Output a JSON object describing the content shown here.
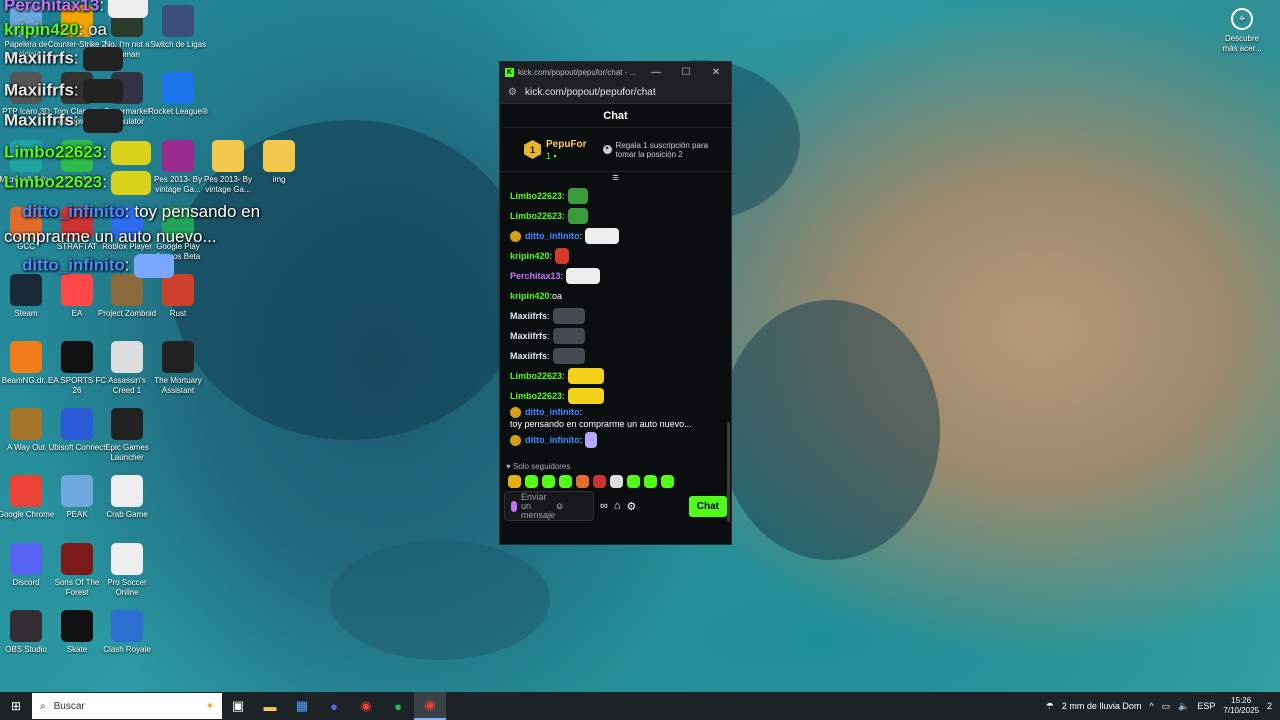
{
  "desktop_icons": [
    {
      "label": "Papelera de reciclaje",
      "icon": "recycle-bin-icon",
      "color": "#6aa6d9"
    },
    {
      "label": "Counter-Strike 2",
      "icon": "cs2-icon",
      "color": "#f0a500"
    },
    {
      "label": "No, I'm not a Human",
      "icon": "game-icon",
      "color": "#2b3b2b"
    },
    {
      "label": "Switch de Ligas",
      "icon": "league-icon",
      "color": "#3a4e7a"
    },
    {
      "label": "PTP Icaro 3D",
      "icon": "ptp-icon",
      "color": "#555"
    },
    {
      "label": "Tom Clancy's Rainbow Six",
      "icon": "r6-icon",
      "color": "#333"
    },
    {
      "label": "Supermarket Simulator",
      "icon": "supermarket-icon",
      "color": "#334"
    },
    {
      "label": "Rocket League®",
      "icon": "rocket-league-icon",
      "color": "#1a73e8"
    },
    {
      "label": "Microsoft Edge",
      "icon": "edge-icon",
      "color": "#1fa3a3"
    },
    {
      "label": "WhatsApp",
      "icon": "app-icon",
      "color": "#2dbb4d"
    },
    {
      "label": "Pes 2013- By vintage Ga...",
      "icon": "rar-icon",
      "color": "#9b2b8e"
    },
    {
      "label": "Pes 2013- By vintage Ga...",
      "icon": "folder-icon",
      "color": "#f2c94c"
    },
    {
      "label": "img",
      "icon": "folder-icon",
      "color": "#f2c94c"
    },
    {
      "label": "GCC",
      "icon": "gcc-icon",
      "color": "#e06b2d"
    },
    {
      "label": "STRAFTAT",
      "icon": "straftat-icon",
      "color": "#c33"
    },
    {
      "label": "Roblox Player",
      "icon": "roblox-icon",
      "color": "#2b6cf0"
    },
    {
      "label": "Google Play Juegos Beta",
      "icon": "play-games-icon",
      "color": "#22a55a"
    },
    {
      "label": "Steam",
      "icon": "steam-icon",
      "color": "#1b2838"
    },
    {
      "label": "EA",
      "icon": "ea-icon",
      "color": "#ff4747"
    },
    {
      "label": "Project Zomboid",
      "icon": "zomboid-icon",
      "color": "#8a6a3a"
    },
    {
      "label": "Rust",
      "icon": "rust-icon",
      "color": "#cd412b"
    },
    {
      "label": "BeamNG.dr...",
      "icon": "beamng-icon",
      "color": "#f07c1a"
    },
    {
      "label": "EA SPORTS FC 26",
      "icon": "fc26-icon",
      "color": "#111"
    },
    {
      "label": "Assassin's Creed 1",
      "icon": "assassins-creed-icon",
      "color": "#ddd"
    },
    {
      "label": "The Mortuary Assistant",
      "icon": "mortuary-icon",
      "color": "#222"
    },
    {
      "label": "A Way Out",
      "icon": "a-way-out-icon",
      "color": "#a3742a"
    },
    {
      "label": "Ubisoft Connect",
      "icon": "ubisoft-icon",
      "color": "#2a5bd7"
    },
    {
      "label": "Epic Games Launcher",
      "icon": "epic-icon",
      "color": "#222"
    },
    {
      "label": "Google Chrome",
      "icon": "chrome-icon",
      "color": "#ea4335"
    },
    {
      "label": "PEAK",
      "icon": "peak-icon",
      "color": "#6fa8dc"
    },
    {
      "label": "Crab Game",
      "icon": "crab-game-icon",
      "color": "#eee"
    },
    {
      "label": "Discord",
      "icon": "discord-icon",
      "color": "#5865f2"
    },
    {
      "label": "Sons Of The Forest",
      "icon": "sons-forest-icon",
      "color": "#7a1a1a"
    },
    {
      "label": "Pro Soccer Online",
      "icon": "soccer-icon",
      "color": "#eee"
    },
    {
      "label": "OBS Studio",
      "icon": "obs-icon",
      "color": "#302e31"
    },
    {
      "label": "Skate",
      "icon": "skate-icon",
      "color": "#111"
    },
    {
      "label": "Clash Royale",
      "icon": "clash-royale-icon",
      "color": "#2d6fd1"
    }
  ],
  "overlay_chat": [
    {
      "user": "Perchitax13",
      "text": ":",
      "color": "purple"
    },
    {
      "user": "kripin420",
      "text": ": oa",
      "color": "green"
    },
    {
      "user": "Maxiifrfs",
      "text": ":",
      "color": "white"
    },
    {
      "user": "Maxiifrfs",
      "text": ":",
      "color": "white"
    },
    {
      "user": "Maxiifrfs",
      "text": ":",
      "color": "white"
    },
    {
      "user": "Limbo22623",
      "text": ":",
      "color": "green"
    },
    {
      "user": "Limbo22623",
      "text": ":",
      "color": "green"
    },
    {
      "user": "ditto_infinito",
      "text": ": toy pensando en",
      "color": "blue"
    },
    {
      "user": "",
      "text": "comprarme un auto nuevo...",
      "color": "white"
    },
    {
      "user": "ditto_infinito",
      "text": ":",
      "color": "blue"
    }
  ],
  "window": {
    "title": "kick.com/popout/pepufor/chat - ...",
    "url": "kick.com/popout/pepufor/chat",
    "minimize": "—",
    "maximize": "☐",
    "close": "✕"
  },
  "chat": {
    "header": "Chat",
    "pinned": {
      "rank": "1",
      "user": "PepuFor",
      "count": "1",
      "gift_text": "Regala 1 suscripción para tomar la posición 2"
    },
    "messages": [
      {
        "user": "Limbo22623",
        "sep": ":",
        "text": "",
        "color": "green",
        "badge": false,
        "emote": "frog"
      },
      {
        "user": "Limbo22623",
        "sep": ":",
        "text": "",
        "color": "green",
        "badge": false,
        "emote": "frog"
      },
      {
        "user": "ditto_infinito",
        "sep": ":",
        "text": "",
        "color": "blue",
        "badge": true,
        "emote": "car"
      },
      {
        "user": "kripin420",
        "sep": ":",
        "text": "",
        "color": "green",
        "badge": false,
        "emote": "red"
      },
      {
        "user": "Perchitax13",
        "sep": ":",
        "text": "",
        "color": "purple",
        "badge": false,
        "emote": "car"
      },
      {
        "user": "kripin420",
        "sep": ":",
        "text": " oa",
        "color": "green",
        "badge": false,
        "emote": ""
      },
      {
        "user": "Maxiifrfs",
        "sep": ":",
        "text": "",
        "color": "white",
        "badge": false,
        "emote": "face"
      },
      {
        "user": "Maxiifrfs",
        "sep": ":",
        "text": "",
        "color": "white",
        "badge": false,
        "emote": "face"
      },
      {
        "user": "Maxiifrfs",
        "sep": ":",
        "text": "",
        "color": "white",
        "badge": false,
        "emote": "face"
      },
      {
        "user": "Limbo22623",
        "sep": ":",
        "text": "",
        "color": "green",
        "badge": false,
        "emote": "minion"
      },
      {
        "user": "Limbo22623",
        "sep": ":",
        "text": "",
        "color": "green",
        "badge": false,
        "emote": "minion"
      },
      {
        "user": "ditto_infinito",
        "sep": ":",
        "text": " toy pensando en comprarme un auto nuevo...",
        "color": "blue",
        "badge": true,
        "emote": ""
      },
      {
        "user": "ditto_infinito",
        "sep": ":",
        "text": "",
        "color": "blue",
        "badge": true,
        "emote": "drop"
      }
    ],
    "followers_only": "Solo seguidores",
    "input_placeholder": "Enviar un mensaje",
    "send_label": "Chat"
  },
  "top_right_icon": {
    "label": "Descubre más acer...",
    "icon": "discover-icon"
  },
  "taskbar": {
    "search_placeholder": "Buscar",
    "weather": "2 mm de lluvia Dom",
    "language": "ESP",
    "time": "15:26",
    "date": "7/10/2025",
    "notifications": "2"
  },
  "colors": {
    "kick_green": "#53fc18",
    "window_bg": "#0b0e0f"
  }
}
